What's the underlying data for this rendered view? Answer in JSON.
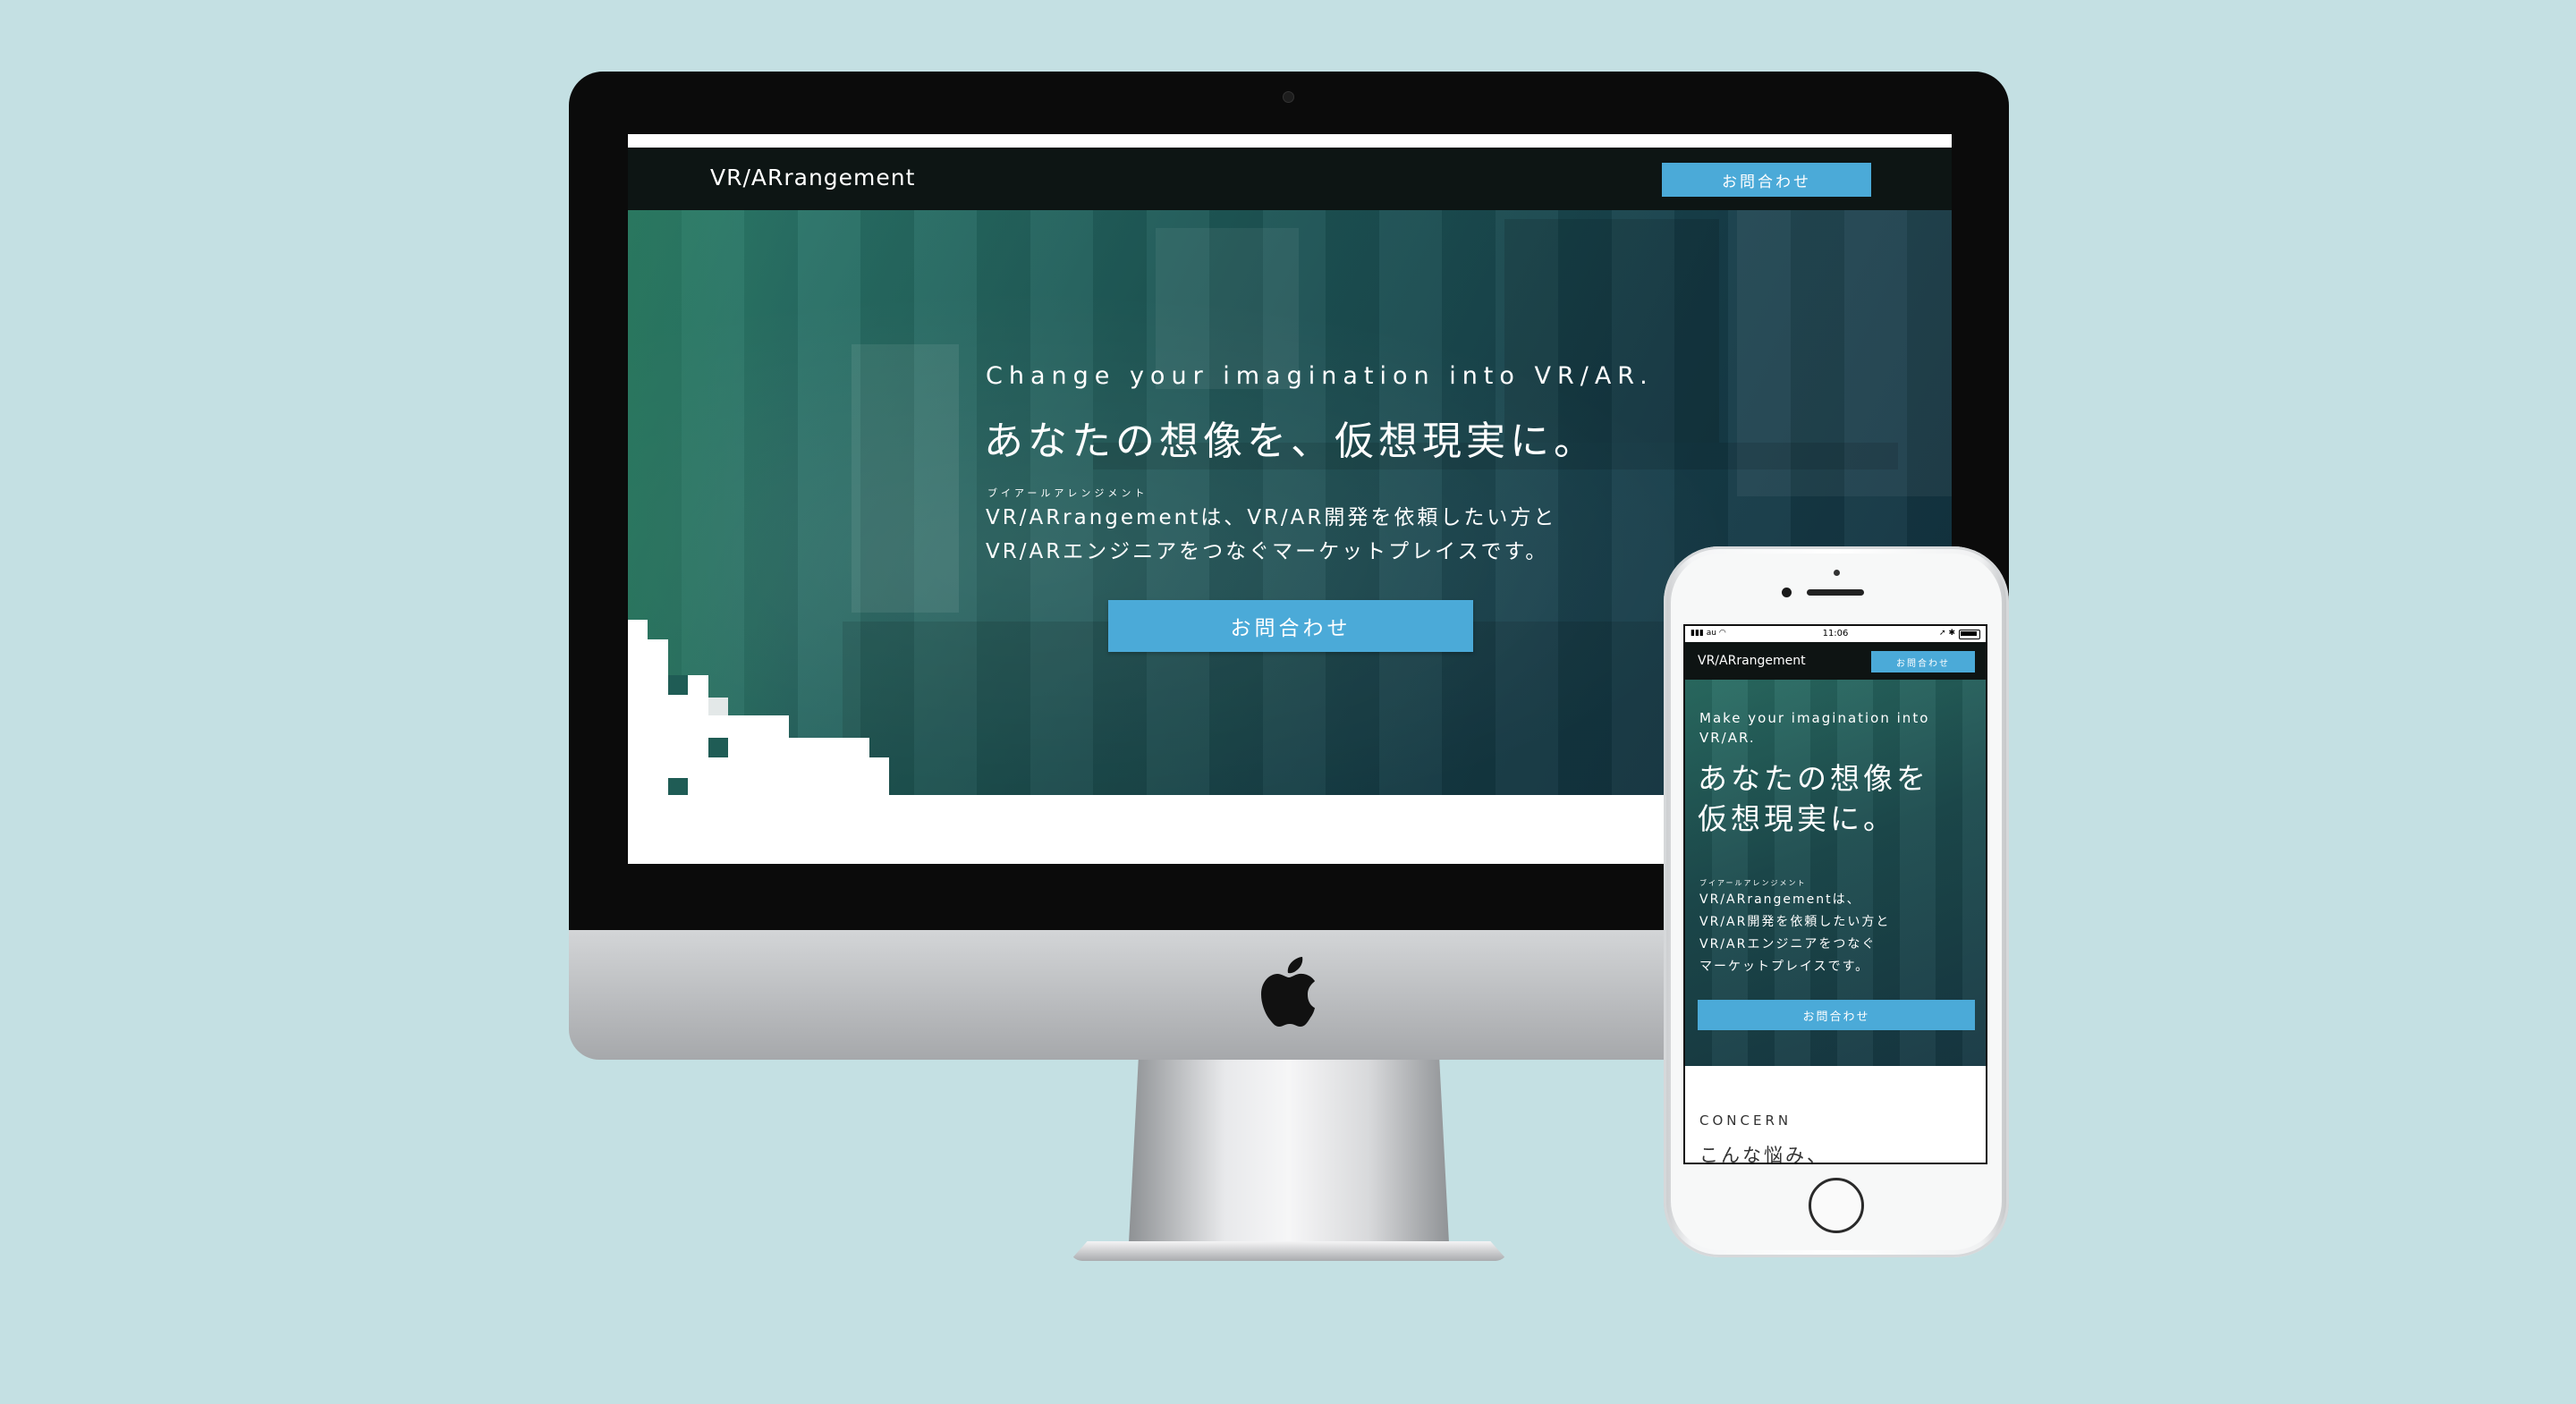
{
  "desktop": {
    "header": {
      "logo": "VR/ARrangement",
      "contact_button": "お問合わせ"
    },
    "hero": {
      "tagline_en": "Change your imagination into VR/AR.",
      "headline_jp": "あなたの想像を、仮想現実に。",
      "ruby": "ブイアールアレンジメント",
      "description_line1": "VR/ARrangementは、VR/AR開発を依頼したい方と",
      "description_line2": "VR/ARエンジニアをつなぐマーケットプレイスです。",
      "cta_button": "お問合わせ"
    }
  },
  "mobile": {
    "status_bar": {
      "carrier": "au",
      "time": "11:06"
    },
    "header": {
      "logo": "VR/ARrangement",
      "contact_button": "お問合わせ"
    },
    "hero": {
      "tagline_en": "Make your imagination into VR/AR.",
      "headline_line1": "あなたの想像を",
      "headline_line2": "仮想現実に。",
      "ruby": "ブイアールアレンジメント",
      "description_line1": "VR/ARrangementは、",
      "description_line2": "VR/AR開発を依頼したい方と",
      "description_line3": "VR/ARエンジニアをつなぐ",
      "description_line4": "マーケットプレイスです。",
      "cta_button": "お問合わせ"
    },
    "concern": {
      "label": "CONCERN",
      "heading": "こんな悩み、"
    }
  },
  "colors": {
    "background": "#c4e0e3",
    "accent": "#4baad8",
    "header_bg": "#0d1514",
    "hero_teal": "#1f5a58"
  },
  "icons": {
    "brand": "apple-logo-icon"
  }
}
